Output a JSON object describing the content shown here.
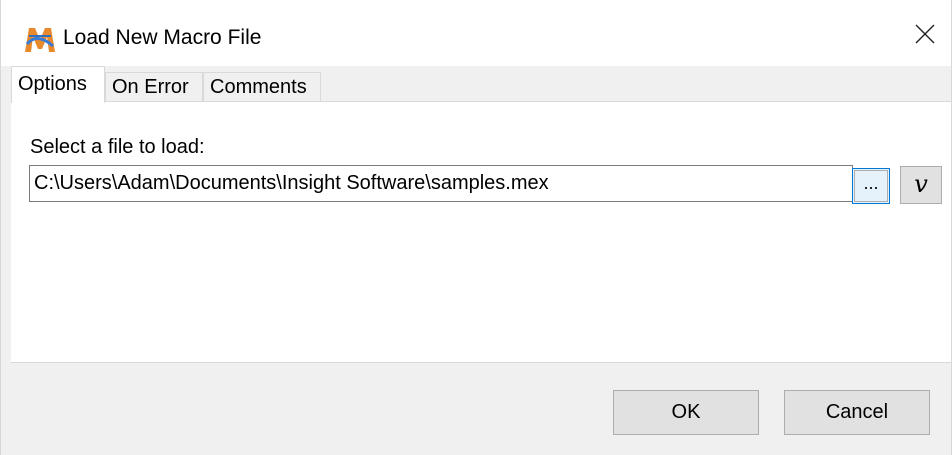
{
  "window": {
    "title": "Load New Macro File",
    "app_icon": "macro-app-icon",
    "close_icon": "close-icon"
  },
  "tabs": [
    {
      "label": "Options",
      "active": true
    },
    {
      "label": "On Error",
      "active": false
    },
    {
      "label": "Comments",
      "active": false
    }
  ],
  "options": {
    "select_label": "Select a file to load:",
    "file_path": "C:\\Users\\Adam\\Documents\\Insight Software\\samples.mex",
    "browse_label": "...",
    "variable_label": "v"
  },
  "buttons": {
    "ok": "OK",
    "cancel": "Cancel"
  },
  "colors": {
    "focus_border": "#0078d7",
    "button_bg": "#e1e1e1",
    "dialog_bg": "#f0f0f0"
  }
}
